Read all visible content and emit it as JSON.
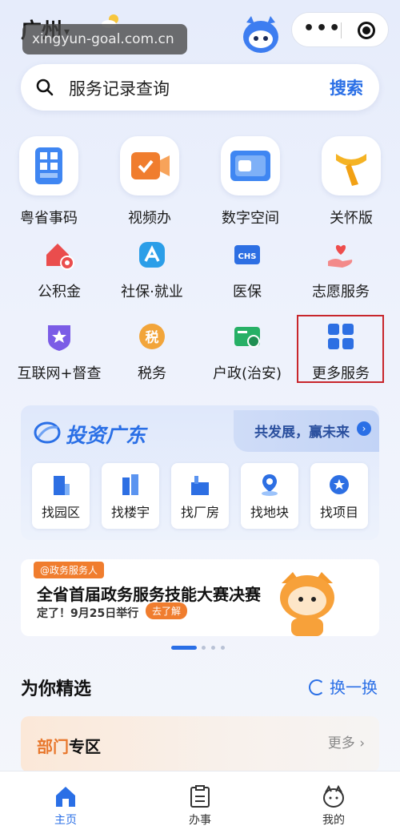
{
  "header": {
    "city": "广州",
    "watermark": "xingyun-goal.com.cn"
  },
  "search": {
    "placeholder": "服务记录查询",
    "button": "搜索"
  },
  "primary_services": [
    {
      "label": "粤省事码",
      "icon": "qr-code-icon"
    },
    {
      "label": "视频办",
      "icon": "video-icon"
    },
    {
      "label": "数字空间",
      "icon": "folder-icon"
    },
    {
      "label": "关怀版",
      "icon": "scarf-icon"
    }
  ],
  "secondary_services": [
    {
      "label": "公积金",
      "icon": "house-icon"
    },
    {
      "label": "社保·就业",
      "icon": "social-security-icon"
    },
    {
      "label": "医保",
      "icon": "chs-icon"
    },
    {
      "label": "志愿服务",
      "icon": "heart-hand-icon"
    },
    {
      "label": "互联网+督查",
      "icon": "star-shield-icon"
    },
    {
      "label": "税务",
      "icon": "tax-icon"
    },
    {
      "label": "户政(治安)",
      "icon": "id-card-icon"
    },
    {
      "label": "更多服务",
      "icon": "grid-icon"
    }
  ],
  "invest": {
    "title": "投资广东",
    "slogan": "共发展，赢未来",
    "items": [
      {
        "label": "找园区"
      },
      {
        "label": "找楼宇"
      },
      {
        "label": "找厂房"
      },
      {
        "label": "找地块"
      },
      {
        "label": "找项目"
      }
    ]
  },
  "banner": {
    "tag": "@政务服务人",
    "headline": "全省首届政务服务技能大赛决赛",
    "sub": "定了！9月25日举行",
    "cta": "去了解"
  },
  "section": {
    "title": "为你精选",
    "refresh": "换一换"
  },
  "dept": {
    "title_a": "部门",
    "title_b": "专区",
    "more": "更多"
  },
  "tabbar": [
    {
      "label": "主页",
      "active": true
    },
    {
      "label": "办事",
      "active": false
    },
    {
      "label": "我的",
      "active": false
    }
  ],
  "colors": {
    "accent": "#2a6fe6",
    "orange": "#f07d2e",
    "highlight_border": "#c8262c"
  }
}
